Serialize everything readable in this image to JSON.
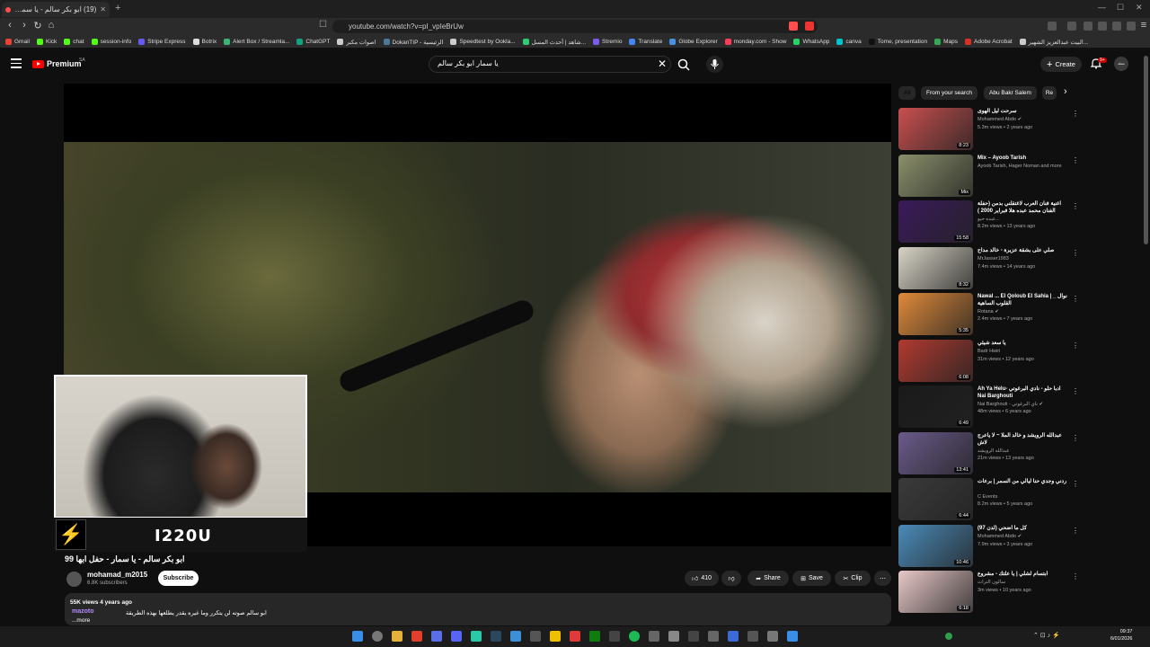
{
  "browser": {
    "tab_title": "(19) ابو بكر سالم - يا سمار - حف",
    "url": "youtube.com/watch?v=pI_vpIeBrUw",
    "bookmarks": [
      "Gmail",
      "Kick",
      "chat",
      "session-info",
      "Stripe Express",
      "Botrix",
      "Alert Box / Streamla...",
      "ChatGPT",
      "اصوات مكبر",
      "DokanTIP - الرئيسية",
      "Speedtest by Ookla...",
      "شاهد | أحدث المسل...",
      "Stremio",
      "Translate",
      "Globe Explorer",
      "monday.com - Show",
      "WhatsApp",
      "canva",
      "Tome, presentation",
      "Maps",
      "Adobe Acrobat",
      "البيت عبدالعزيز الشهير..."
    ]
  },
  "youtube": {
    "logo_text": "Premium",
    "region": "SA",
    "search_query": "يا سمار ابو بكر سالم",
    "create_label": "Create",
    "notif_count": "9+",
    "avatar_text": "شعلة"
  },
  "webcam": {
    "handle": "I220U"
  },
  "video": {
    "title": "ابو بكر سالم - يا سمار - حفل ابها 99",
    "channel": "mohamad_m2015",
    "subscribers": "6.8K subscribers",
    "subscribe_label": "Subscribe",
    "likes": "410",
    "share_label": "Share",
    "save_label": "Save",
    "clip_label": "Clip",
    "views_age": "55K views  4 years ago",
    "description": "ابو سالم صوته لن يتكرر وما غيره يقدر يطلعها بهذه الطريقة",
    "more": "...more",
    "chat_user": "mazoto"
  },
  "sidebar": {
    "chips": [
      "All",
      "From your search",
      "Abu Bakr Salem",
      "Re"
    ],
    "items": [
      {
        "title": "سرحت ليل الهوى",
        "channel": "Mohammed Abdo ✔",
        "meta": "5.3m views • 2 years ago",
        "duration": "8:23",
        "color": "#c94f4f"
      },
      {
        "title": "Mix – Ayoob Tarish",
        "channel": "Ayoob Tarish, Hager Noman and more",
        "meta": "",
        "duration": "Mix",
        "color": "#8a8f6a"
      },
      {
        "title": "اغنية فنان العرب لاغتقلني بدمن (حفلة الفنان محمد عبده هلا فبراير 2000 )",
        "channel": "عبده حيو...",
        "meta": "8.2m views • 13 years ago",
        "duration": "15:58",
        "color": "#3a1a5a"
      },
      {
        "title": "صلي على بشقة عزيرة - خالد مداح",
        "channel": "MrJasser1983",
        "meta": "7.4m views • 14 years ago",
        "duration": "8:32",
        "color": "#d8d4c6"
      },
      {
        "title": "Nawal ... El Qoloub El Sahia | نوال _ القلوب الساهية",
        "channel": "Rotana ✔",
        "meta": "2.4m views • 7 years ago",
        "duration": "5:35",
        "color": "#e08a3a"
      },
      {
        "title": "يا سعد شيئي",
        "channel": "Badr Hwiri",
        "meta": "31m views • 12 years ago",
        "duration": "6:08",
        "color": "#b03a30"
      },
      {
        "title": "Ah Ya Helu- ادبا حلو - نادي البرغوتي Nai Barghouti",
        "channel": "Nai Barghouti - ناي البرغوتي ✔",
        "meta": "48m views • 6 years ago",
        "duration": "6:49",
        "color": "#1a1a1a"
      },
      {
        "title": "عبدالله الرويشد و خالد الملا ~ لا ياعرج لاش",
        "channel": "عبدالله الرويشد",
        "meta": "21m views • 13 years ago",
        "duration": "13:41",
        "color": "#6a5a8a"
      },
      {
        "title": "ردني وجدي حنا ليالي من السمر | برعات",
        "channel": "C Events",
        "meta": "8.2m views • 5 years ago",
        "duration": "6:44",
        "color": "#3a3a3a"
      },
      {
        "title": "كل ما اضحي (لدن 97)",
        "channel": "Mohammed Abdo ✔",
        "meta": "7.9m views • 3 years ago",
        "duration": "10:46",
        "color": "#4a8ab8"
      },
      {
        "title": "ابتسام لشلي | يا علتك - مشروع",
        "channel": "سالون التراث",
        "meta": "3m views • 10 years ago",
        "duration": "6:18",
        "color": "#e8c8c8"
      }
    ]
  },
  "taskbar": {
    "time": "09:37",
    "date": "6/01/2026"
  }
}
